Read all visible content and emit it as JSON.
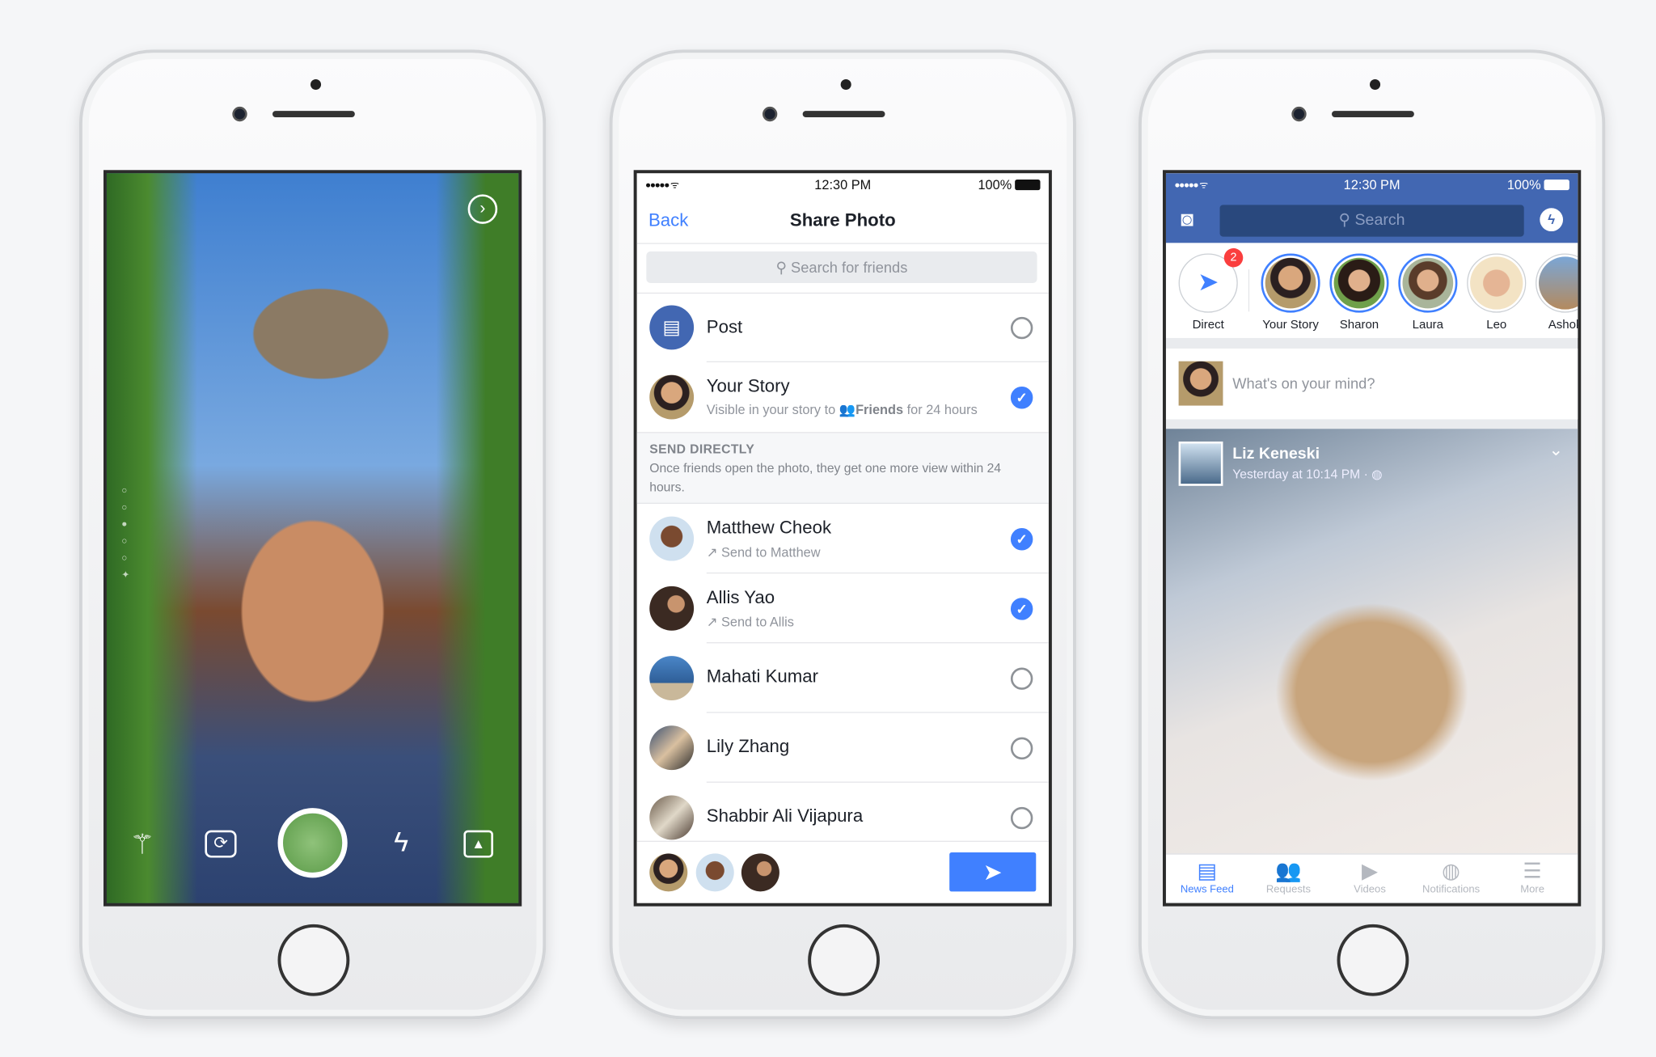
{
  "camera": {
    "icons": [
      "magic-wand-icon",
      "flip-camera-icon",
      "shutter-button",
      "flash-off-icon",
      "gallery-icon",
      "next-arrow-icon"
    ]
  },
  "share": {
    "status": {
      "time": "12:30 PM",
      "battery": "100%"
    },
    "back": "Back",
    "title": "Share Photo",
    "search_placeholder": "Search for friends",
    "post": "Post",
    "your_story": {
      "name": "Your Story",
      "sub_prefix": "Visible in your story to",
      "audience": "Friends",
      "sub_suffix": "for 24 hours",
      "checked": true
    },
    "section": {
      "title": "SEND DIRECTLY",
      "desc": "Once friends open the photo, they get one more view within 24 hours."
    },
    "friends": [
      {
        "name": "Matthew Cheok",
        "sub": "Send to Matthew",
        "checked": true
      },
      {
        "name": "Allis Yao",
        "sub": "Send to Allis",
        "checked": true
      },
      {
        "name": "Mahati Kumar",
        "sub": "",
        "checked": false
      },
      {
        "name": "Lily Zhang",
        "sub": "",
        "checked": false
      },
      {
        "name": "Shabbir Ali Vijapura",
        "sub": "",
        "checked": false
      }
    ],
    "accent": "#4080ff"
  },
  "feed": {
    "status": {
      "time": "12:30 PM",
      "battery": "100%"
    },
    "search_placeholder": "Search",
    "stories": [
      "Direct",
      "Your Story",
      "Sharon",
      "Laura",
      "Leo",
      "Ashok"
    ],
    "direct_badge": "2",
    "composer_placeholder": "What's on your mind?",
    "post": {
      "author": "Liz Keneski",
      "time": "Yesterday at 10:14 PM ·"
    },
    "tabs": [
      "News Feed",
      "Requests",
      "Videos",
      "Notifications",
      "More"
    ],
    "brand": "#4267b2"
  }
}
